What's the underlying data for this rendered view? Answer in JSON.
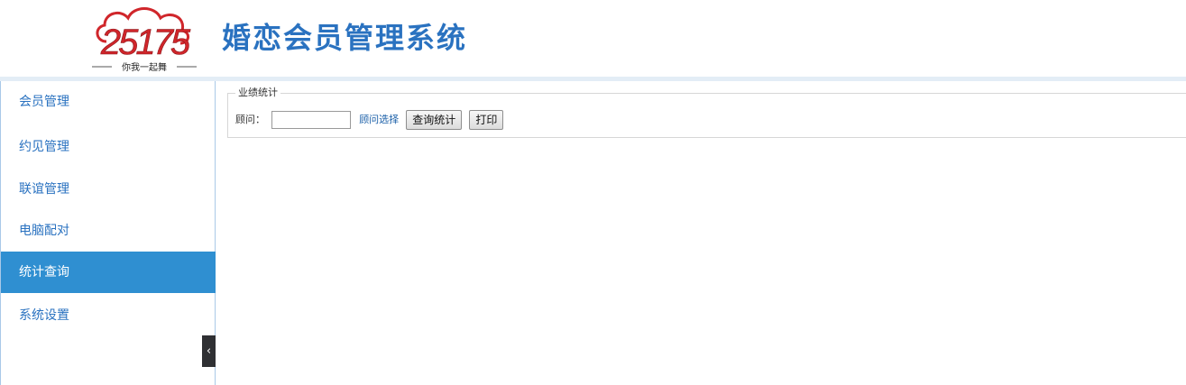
{
  "header": {
    "logo_number": "25175",
    "logo_slogan": "你我一起舞",
    "app_title": "婚恋会员管理系统",
    "colors": {
      "title": "#2a72c0",
      "logo_red": "#d0262b"
    }
  },
  "sidebar": {
    "items": [
      {
        "label": "会员管理",
        "active": false
      },
      {
        "label": "约见管理",
        "active": false
      },
      {
        "label": "联谊管理",
        "active": false
      },
      {
        "label": "电脑配对",
        "active": false
      },
      {
        "label": "统计查询",
        "active": true
      },
      {
        "label": "系统设置",
        "active": false
      }
    ],
    "collapse_icon": "‹",
    "colors": {
      "active_bg": "#2f8fd1",
      "item_text": "#2a72c0"
    }
  },
  "main": {
    "legend": "业绩统计",
    "consultant_label": "顾问：",
    "consultant_value": "",
    "consultant_select_link": "顾问选择",
    "query_button": "查询统计",
    "print_button": "打印"
  }
}
